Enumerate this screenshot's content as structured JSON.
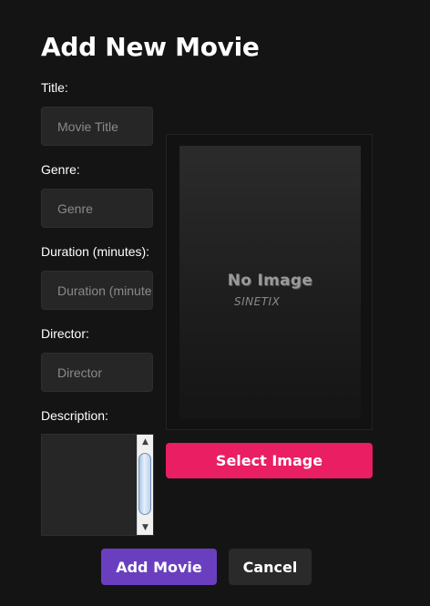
{
  "page": {
    "title": "Add New Movie"
  },
  "form": {
    "title": {
      "label": "Title:",
      "placeholder": "Movie Title",
      "value": ""
    },
    "genre": {
      "label": "Genre:",
      "placeholder": "Genre",
      "value": ""
    },
    "duration": {
      "label": "Duration (minutes):",
      "placeholder": "Duration (minutes)",
      "value": ""
    },
    "director": {
      "label": "Director:",
      "placeholder": "Director",
      "value": ""
    },
    "description": {
      "label": "Description:",
      "value": ""
    }
  },
  "image_preview": {
    "placeholder_text": "No Image",
    "brand_text": "SINETIX",
    "select_label": "Select Image"
  },
  "actions": {
    "add_label": "Add Movie",
    "cancel_label": "Cancel"
  },
  "icons": {
    "scroll_up": "scroll-up-arrow-icon",
    "scroll_down": "scroll-down-arrow-icon"
  },
  "colors": {
    "background": "#141414",
    "input_background": "#262626",
    "select_button": "#e91e63",
    "add_button": "#6a3fbf",
    "cancel_button": "#2a2a2a",
    "text": "#ffffff",
    "placeholder": "#8a8a8a"
  }
}
